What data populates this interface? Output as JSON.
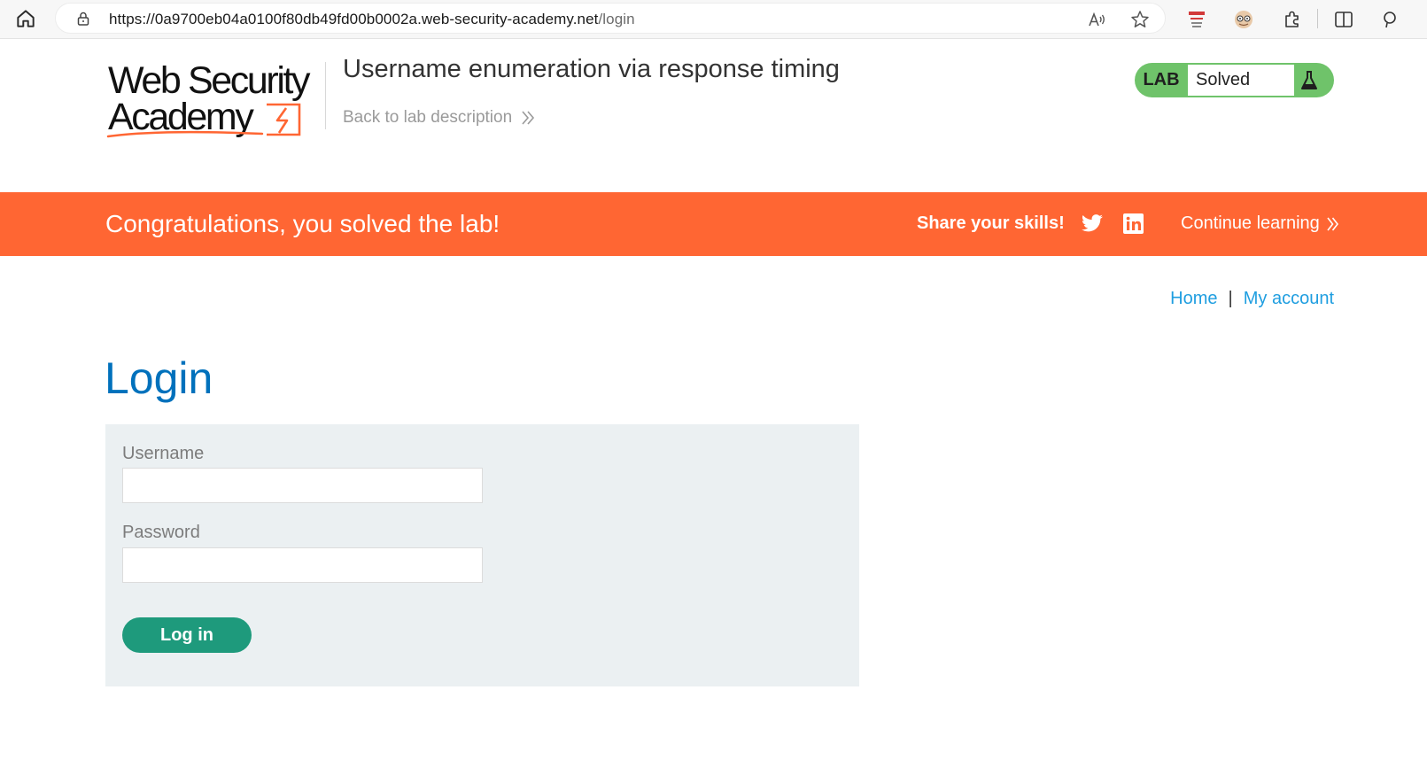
{
  "browser": {
    "url_main": "https://0a9700eb04a0100f80db49fd00b0002a.web-security-academy.net",
    "url_path": "/login"
  },
  "header": {
    "logo_line1": "Web Security",
    "logo_line2": "Academy",
    "lab_title": "Username enumeration via response timing",
    "back_link": "Back to lab description",
    "lab_badge_label": "LAB",
    "lab_status": "Solved"
  },
  "banner": {
    "message": "Congratulations, you solved the lab!",
    "share": "Share your skills!",
    "continue": "Continue learning"
  },
  "nav": {
    "home": "Home",
    "separator": "|",
    "account": "My account"
  },
  "login": {
    "heading": "Login",
    "username_label": "Username",
    "username_value": "",
    "password_label": "Password",
    "password_value": "",
    "submit": "Log in"
  },
  "colors": {
    "accent_orange": "#ff6633",
    "link_blue": "#1f9ee0",
    "heading_blue": "#0071bc",
    "button_green": "#1e9a7c",
    "badge_green": "#6fc36a"
  }
}
